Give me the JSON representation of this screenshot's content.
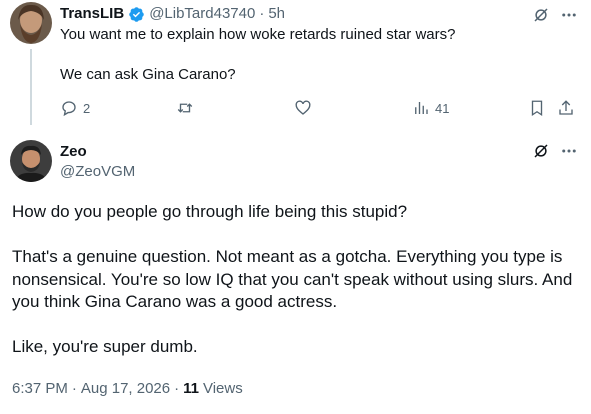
{
  "tweet1": {
    "display_name": "TransLIB",
    "handle": "@LibTard43740",
    "sep": "·",
    "time": "5h",
    "lines": [
      "You want me to explain how woke retards ruined star wars?",
      "We can ask Gina Carano?"
    ],
    "replies": "2",
    "views": "41",
    "icons": [
      "grok-icon",
      "more-icon",
      "reply-icon",
      "retweet-icon",
      "like-icon",
      "views-icon",
      "bookmark-icon",
      "share-icon"
    ]
  },
  "tweet2": {
    "display_name": "Zeo",
    "handle": "@ZeoVGM",
    "paragraphs": [
      "How do you people go through life being this stupid?",
      "That's a genuine question. Not meant as a gotcha. Everything you type is nonsensical. You're so low IQ that you can't speak without using slurs. And you think Gina Carano was a good actress.",
      "Like, you're super dumb."
    ],
    "time": "6:37 PM",
    "date_sep": "·",
    "date": "Aug 17, 2026",
    "views_sep": "·",
    "views": "11",
    "views_label": "Views",
    "icons": [
      "grok-icon",
      "more-icon"
    ]
  },
  "colors": {
    "verified": "#1d9bf0",
    "gray": "#536471",
    "text": "#0f1419"
  }
}
